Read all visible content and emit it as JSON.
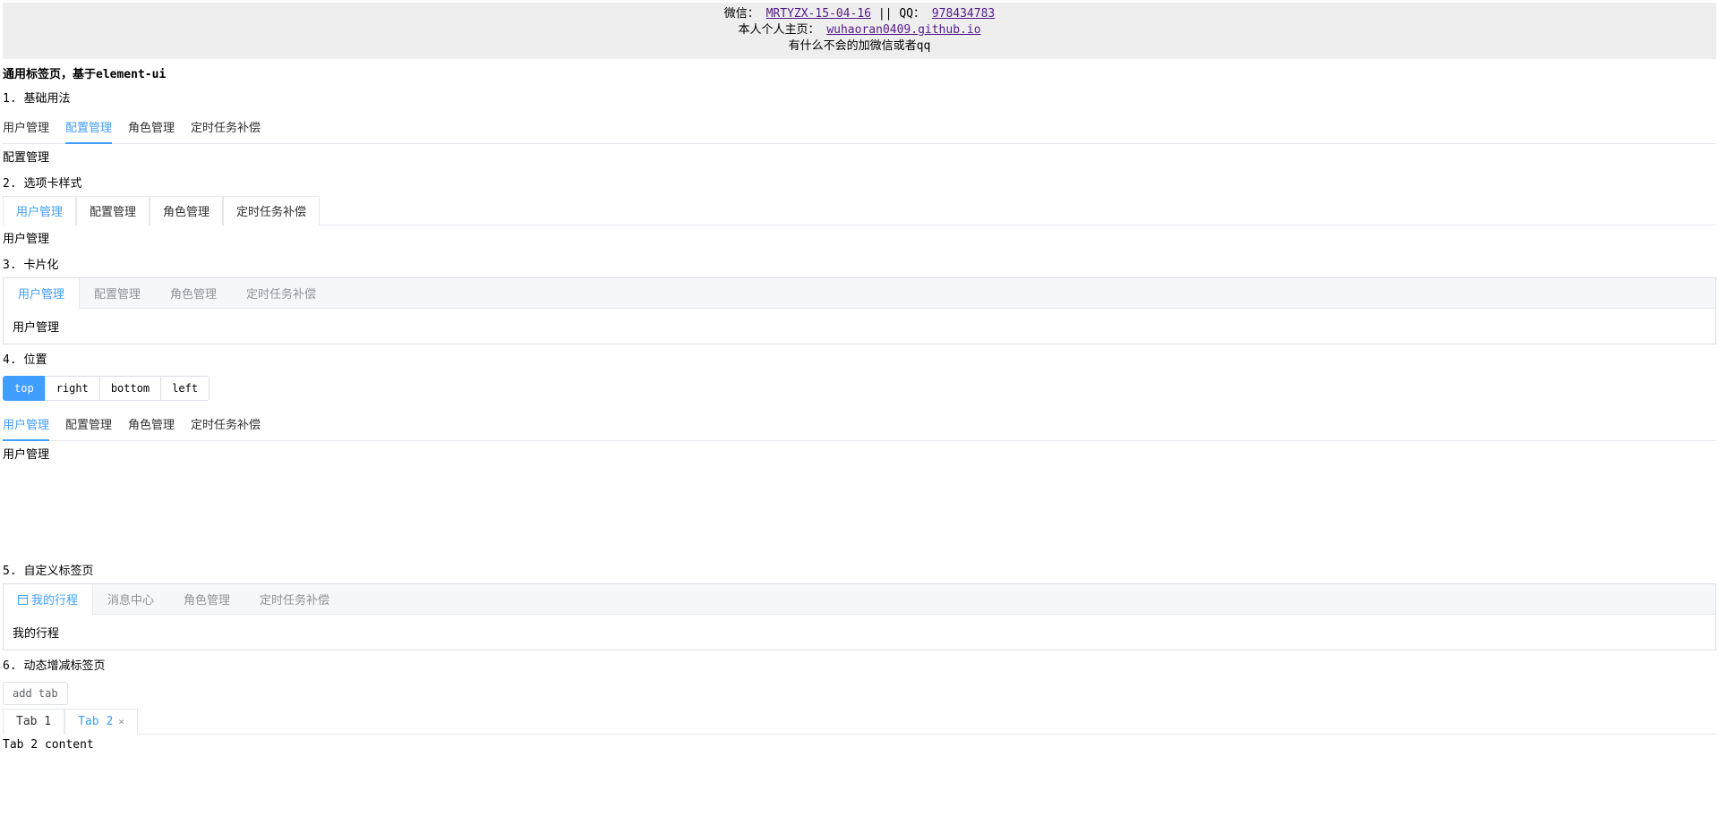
{
  "banner": {
    "wechat_label": "微信：",
    "wechat_link": "MRTYZX-15-04-16",
    "divider": " || ",
    "qq_label": "QQ：",
    "qq_link": "978434783",
    "homepage_label": "本人个人主页：",
    "homepage_link": "wuhaoran0409.github.io",
    "help_text": "有什么不会的加微信或者qq"
  },
  "page_title": "通用标签页，基于element-ui",
  "sections": {
    "s1": {
      "label": "1. 基础用法",
      "tabs": [
        "用户管理",
        "配置管理",
        "角色管理",
        "定时任务补偿"
      ],
      "active_index": 1,
      "pane_text": "配置管理"
    },
    "s2": {
      "label": "2. 选项卡样式",
      "tabs": [
        "用户管理",
        "配置管理",
        "角色管理",
        "定时任务补偿"
      ],
      "active_index": 0,
      "pane_text": "用户管理"
    },
    "s3": {
      "label": "3. 卡片化",
      "tabs": [
        "用户管理",
        "配置管理",
        "角色管理",
        "定时任务补偿"
      ],
      "active_index": 0,
      "pane_text": "用户管理"
    },
    "s4": {
      "label": "4. 位置",
      "positions": [
        "top",
        "right",
        "bottom",
        "left"
      ],
      "active_pos": 0,
      "tabs": [
        "用户管理",
        "配置管理",
        "角色管理",
        "定时任务补偿"
      ],
      "active_index": 0,
      "pane_text": "用户管理"
    },
    "s5": {
      "label": "5. 自定义标签页",
      "tabs": [
        "我的行程",
        "消息中心",
        "角色管理",
        "定时任务补偿"
      ],
      "active_index": 0,
      "pane_text": "我的行程"
    },
    "s6": {
      "label": "6. 动态增减标签页",
      "add_btn": "add tab",
      "tabs": [
        "Tab 1",
        "Tab 2"
      ],
      "active_index": 1,
      "pane_text": "Tab 2 content"
    }
  }
}
